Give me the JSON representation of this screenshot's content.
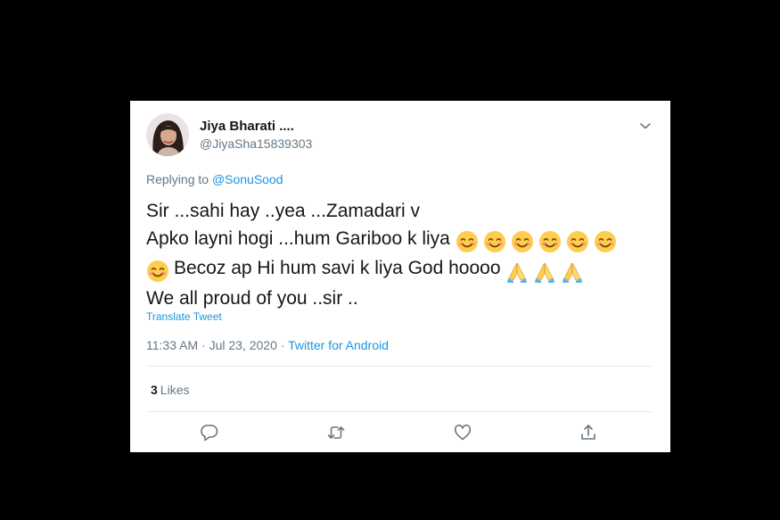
{
  "tweet": {
    "author": {
      "display_name": "Jiya Bharati ....",
      "handle": "@JiyaSha15839303"
    },
    "menu_icon": "chevron-down-icon",
    "replying_to": {
      "prefix": "Replying to",
      "mention": "@SonuSood"
    },
    "text": {
      "line1": "Sir ...sahi hay ..yea ...Zamadari v",
      "line2": "Apko layni hogi ...hum Gariboo k liya",
      "line3": "Becoz ap Hi hum savi k liya God hoooo",
      "line4": "We all proud of you ..sir .."
    },
    "emojis": {
      "smiling": "smiling-face-with-smiling-eyes-emoji",
      "praying": "folded-hands-emoji"
    },
    "translate_label": "Translate Tweet",
    "meta": {
      "time": "11:33 AM",
      "separator1": " · ",
      "date": "Jul 23, 2020",
      "separator2": " · ",
      "source": "Twitter for Android"
    },
    "likes": {
      "count": "3",
      "label": "Likes"
    },
    "actions": [
      "reply-icon",
      "retweet-icon",
      "like-icon",
      "share-icon"
    ]
  },
  "colors": {
    "background": "#000000",
    "card": "#ffffff",
    "primary_text": "#14171a",
    "secondary_text": "#657786",
    "link": "#1b95e0",
    "divider": "#e6ecf0"
  }
}
